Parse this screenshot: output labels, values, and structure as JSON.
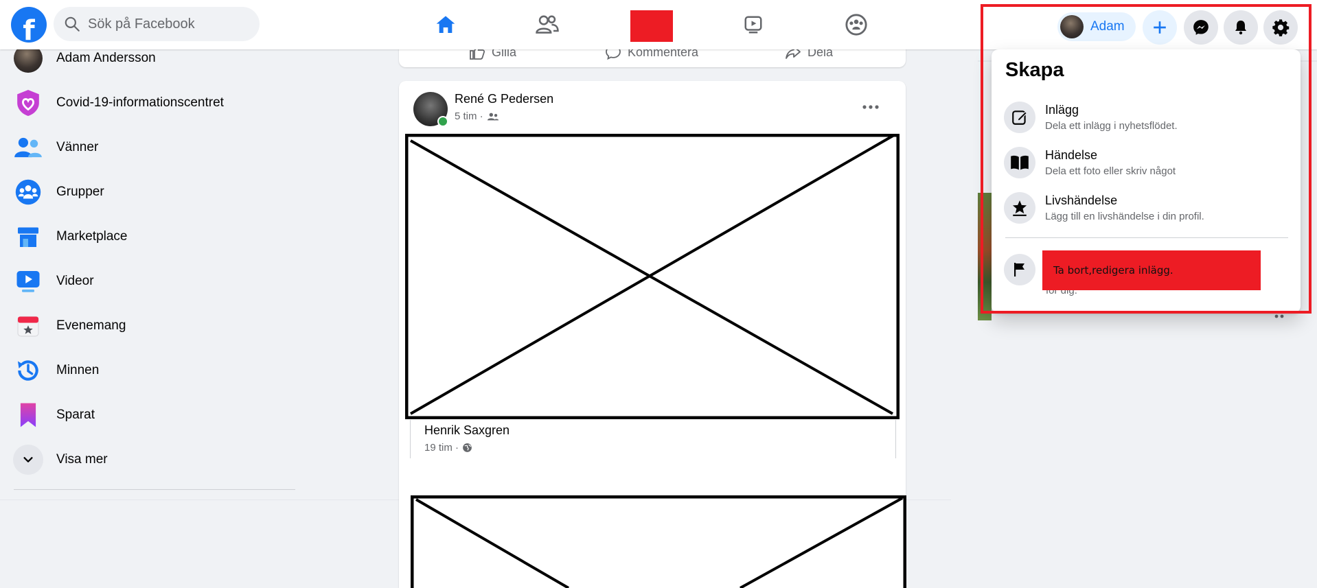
{
  "topbar": {
    "logo_letter": "f",
    "search": {
      "placeholder": "Sök på Facebook"
    },
    "nav": [
      "home-icon",
      "friends-icon",
      "redacted-block",
      "watch-icon",
      "groups-icon"
    ],
    "profile": {
      "name": "Adam"
    }
  },
  "sidebar": {
    "items": [
      {
        "label": "Adam Andersson",
        "icon": "avatar"
      },
      {
        "label": "Covid-19-informationscentret",
        "icon": "covid-info-icon"
      },
      {
        "label": "Vänner",
        "icon": "friends-icon"
      },
      {
        "label": "Grupper",
        "icon": "groups-icon"
      },
      {
        "label": "Marketplace",
        "icon": "marketplace-icon"
      },
      {
        "label": "Videor",
        "icon": "video-icon"
      },
      {
        "label": "Evenemang",
        "icon": "events-icon"
      },
      {
        "label": "Minnen",
        "icon": "memories-icon"
      },
      {
        "label": "Sparat",
        "icon": "saved-icon"
      },
      {
        "label": "Visa mer",
        "icon": "chevron-down-icon"
      }
    ]
  },
  "feed": {
    "actions": {
      "like": "Gilla",
      "comment": "Kommentera",
      "share": "Dela"
    },
    "post": {
      "author": "René G Pedersen",
      "time": "5 tim ·",
      "shared": {
        "author": "Henrik Saxgren",
        "time": "19 tim ·"
      }
    }
  },
  "dropdown": {
    "title": "Skapa",
    "items": [
      {
        "title": "Inlägg",
        "subtitle": "Dela ett inlägg i nyhetsflödet.",
        "icon": "edit-icon"
      },
      {
        "title": "Händelse",
        "subtitle": "Dela ett foto eller skriv något",
        "icon": "book-icon"
      },
      {
        "title": "Livshändelse",
        "subtitle": "Lägg till en livshändelse i din profil.",
        "icon": "star-icon"
      }
    ],
    "report_partial": "för dig.",
    "annotation": "Ta bort,redigera inlägg."
  },
  "colors": {
    "brand": "#1877f2",
    "annotation_red": "#ed1c24",
    "background": "#f0f2f5"
  }
}
